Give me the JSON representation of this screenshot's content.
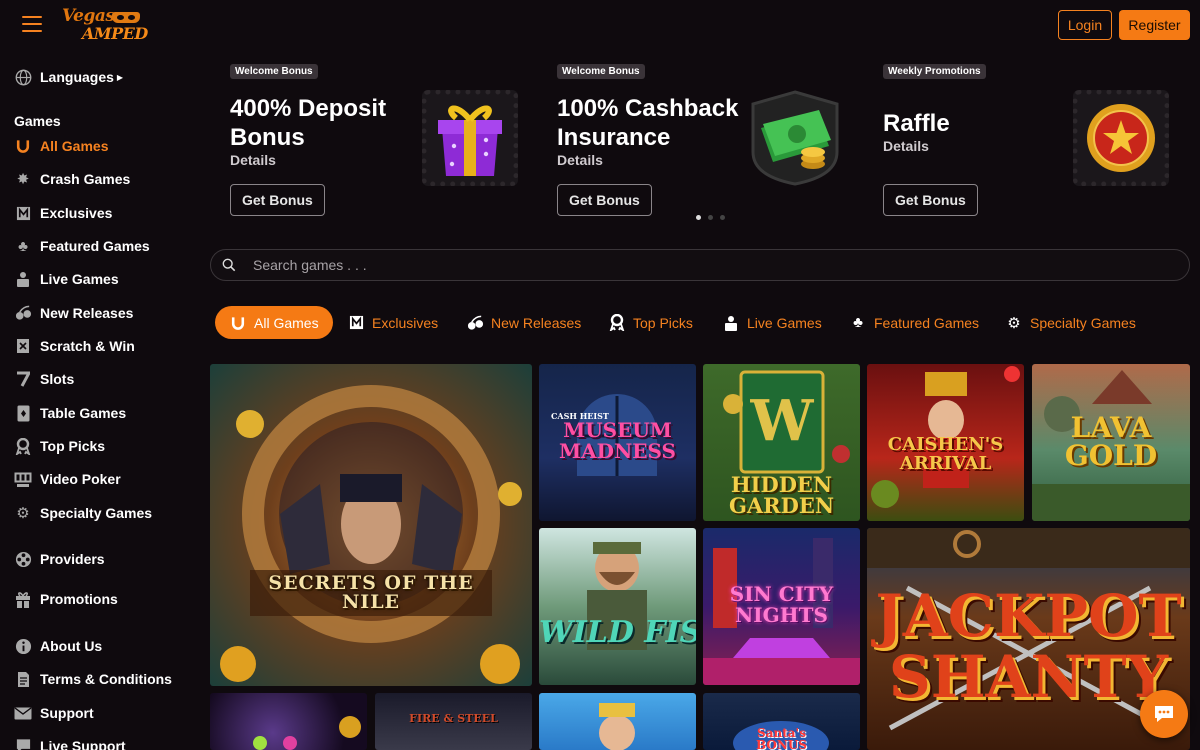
{
  "header": {
    "logo_line1": "Vegas",
    "logo_line2": "AMPED",
    "login_label": "Login",
    "register_label": "Register",
    "accent": "#f58220"
  },
  "sidebar": {
    "languages": "Languages",
    "games_heading": "Games",
    "items": [
      {
        "label": "All Games",
        "icon": "horseshoe-icon",
        "active": true
      },
      {
        "label": "Crash Games",
        "icon": "explosion-icon"
      },
      {
        "label": "Exclusives",
        "icon": "exclusive-icon"
      },
      {
        "label": "Featured Games",
        "icon": "clover-icon"
      },
      {
        "label": "Live Games",
        "icon": "dealer-icon"
      },
      {
        "label": "New Releases",
        "icon": "cherries-icon"
      },
      {
        "label": "Scratch & Win",
        "icon": "scratch-card-icon"
      },
      {
        "label": "Slots",
        "icon": "seven-icon"
      },
      {
        "label": "Table Games",
        "icon": "playing-card-icon"
      },
      {
        "label": "Top Picks",
        "icon": "award-icon"
      },
      {
        "label": "Video Poker",
        "icon": "poker-machine-icon"
      },
      {
        "label": "Specialty Games",
        "icon": "gear-icon"
      }
    ],
    "providers": "Providers",
    "promotions": "Promotions",
    "about": "About Us",
    "terms": "Terms & Conditions",
    "support": "Support",
    "live_support": "Live Support"
  },
  "promos": [
    {
      "badge": "Welcome Bonus",
      "title": "400% Deposit Bonus",
      "details": "Details",
      "button": "Get Bonus",
      "art": "gift-box-icon"
    },
    {
      "badge": "Welcome Bonus",
      "title": "100% Cashback Insurance",
      "details": "Details",
      "button": "Get Bonus",
      "art": "cash-stack-icon"
    },
    {
      "badge": "Weekly Promotions",
      "title": "Raffle",
      "details": "Details",
      "button": "Get Bonus",
      "art": "star-medal-icon"
    }
  ],
  "carousel": {
    "pages": 3,
    "current": 1
  },
  "search": {
    "placeholder": "Search games . . ."
  },
  "tabs": [
    {
      "label": "All Games",
      "icon": "horseshoe-icon",
      "active": true
    },
    {
      "label": "Exclusives",
      "icon": "exclusive-icon"
    },
    {
      "label": "New Releases",
      "icon": "cherries-icon"
    },
    {
      "label": "Top Picks",
      "icon": "award-icon"
    },
    {
      "label": "Live Games",
      "icon": "dealer-icon"
    },
    {
      "label": "Featured Games",
      "icon": "clover-icon"
    },
    {
      "label": "Specialty Games",
      "icon": "gear-icon"
    }
  ],
  "games": [
    {
      "title": "SECRETS OF THE NILE"
    },
    {
      "title": "MUSEUM MADNESS",
      "tag": "CASH HEIST"
    },
    {
      "title": "HIDDEN GARDEN"
    },
    {
      "title": "CAISHEN'S ARRIVAL"
    },
    {
      "title": "LAVA GOLD"
    },
    {
      "title": "WILD FISHIN"
    },
    {
      "title": "SIN CITY NIGHTS"
    },
    {
      "title": "JACKPOT SHANTY"
    },
    {
      "title": ""
    },
    {
      "title": "FIRE & STEEL"
    },
    {
      "title": ""
    },
    {
      "title": "Santa's BONUS"
    }
  ]
}
